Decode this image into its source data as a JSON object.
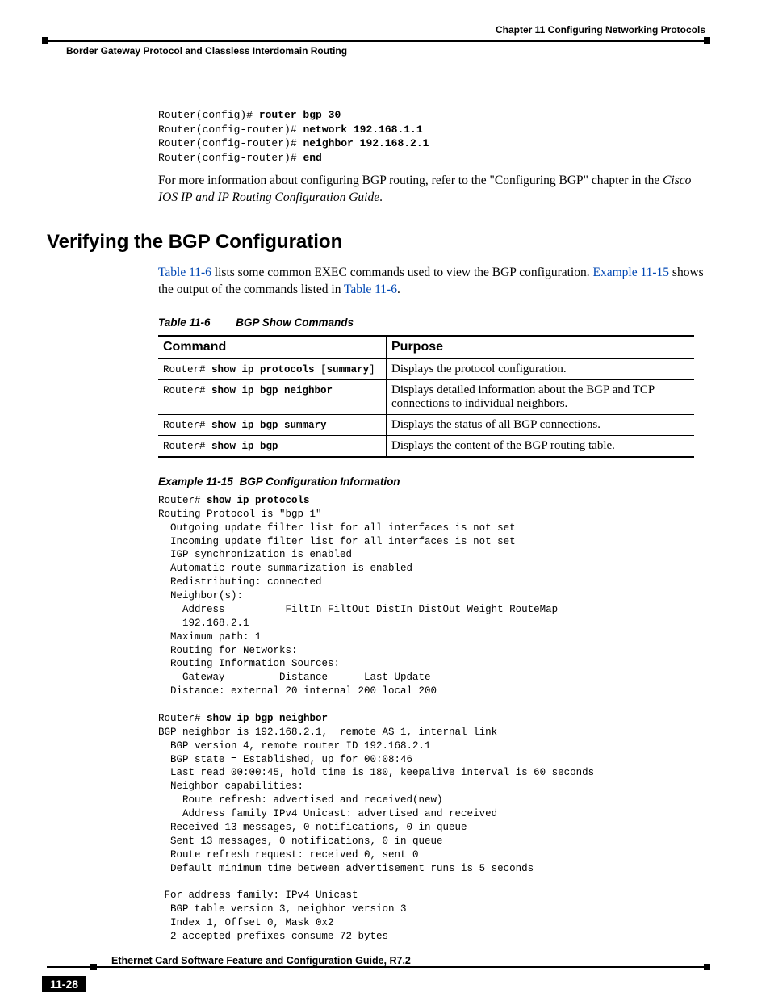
{
  "header": {
    "chapter": "Chapter 11 Configuring Networking Protocols",
    "section": "Border Gateway Protocol and Classless Interdomain Routing"
  },
  "footer": {
    "doc_title": "Ethernet Card Software Feature and Configuration Guide, R7.2",
    "page_num": "11-28"
  },
  "config_block": {
    "l1a": "Router(config)# ",
    "l1b": "router bgp 30",
    "l2a": "Router(config-router)# ",
    "l2b": "network 192.168.1.1",
    "l3a": "Router(config-router)# ",
    "l3b": "neighbor 192.168.2.1",
    "l4a": "Router(config-router)# ",
    "l4b": "end"
  },
  "para1": {
    "t1": "For more information about configuring BGP routing, refer to the \"Configuring BGP\" chapter in the ",
    "t2": "Cisco IOS IP and IP Routing Configuration Guide",
    "t3": "."
  },
  "h2": "Verifying the BGP Configuration",
  "para2": {
    "link1": "Table 11-6",
    "t1": " lists some common EXEC commands used to view the BGP configuration. ",
    "link2": "Example 11-15",
    "t2": " shows the output of the commands listed in ",
    "link3": "Table 11-6",
    "t3": "."
  },
  "tbl": {
    "num": "Table 11-6",
    "title": "BGP Show Commands",
    "h_cmd": "Command",
    "h_purpose": "Purpose",
    "rows": [
      {
        "p1": "Router# ",
        "pb": "show ip protocols",
        "p2": " [",
        "pb2": "summary",
        "p3": "]",
        "purpose": "Displays the protocol configuration."
      },
      {
        "p1": "Router# ",
        "pb": "show ip bgp neighbor",
        "p2": "",
        "pb2": "",
        "p3": "",
        "purpose": "Displays detailed information about the BGP and TCP connections to individual neighbors."
      },
      {
        "p1": "Router# ",
        "pb": "show ip bgp summary",
        "p2": "",
        "pb2": "",
        "p3": "",
        "purpose": "Displays the status of all BGP connections."
      },
      {
        "p1": "Router# ",
        "pb": "show ip bgp",
        "p2": "",
        "pb2": "",
        "p3": "",
        "purpose": "Displays the content of the BGP routing table."
      }
    ]
  },
  "ex": {
    "num": "Example 11-15",
    "title": "BGP Configuration Information"
  },
  "out1": {
    "l1a": "Router# ",
    "l1b": "show ip protocols",
    "body": "Routing Protocol is \"bgp 1\"\n  Outgoing update filter list for all interfaces is not set\n  Incoming update filter list for all interfaces is not set\n  IGP synchronization is enabled\n  Automatic route summarization is enabled\n  Redistributing: connected\n  Neighbor(s):\n    Address          FiltIn FiltOut DistIn DistOut Weight RouteMap\n    192.168.2.1\n  Maximum path: 1\n  Routing for Networks:\n  Routing Information Sources:\n    Gateway         Distance      Last Update\n  Distance: external 20 internal 200 local 200\n"
  },
  "out2": {
    "l1a": "Router# ",
    "l1b": "show ip bgp neighbor",
    "body": "BGP neighbor is 192.168.2.1,  remote AS 1, internal link\n  BGP version 4, remote router ID 192.168.2.1\n  BGP state = Established, up for 00:08:46\n  Last read 00:00:45, hold time is 180, keepalive interval is 60 seconds\n  Neighbor capabilities:\n    Route refresh: advertised and received(new)\n    Address family IPv4 Unicast: advertised and received\n  Received 13 messages, 0 notifications, 0 in queue\n  Sent 13 messages, 0 notifications, 0 in queue\n  Route refresh request: received 0, sent 0\n  Default minimum time between advertisement runs is 5 seconds\n\n For address family: IPv4 Unicast\n  BGP table version 3, neighbor version 3\n  Index 1, Offset 0, Mask 0x2\n  2 accepted prefixes consume 72 bytes"
  }
}
